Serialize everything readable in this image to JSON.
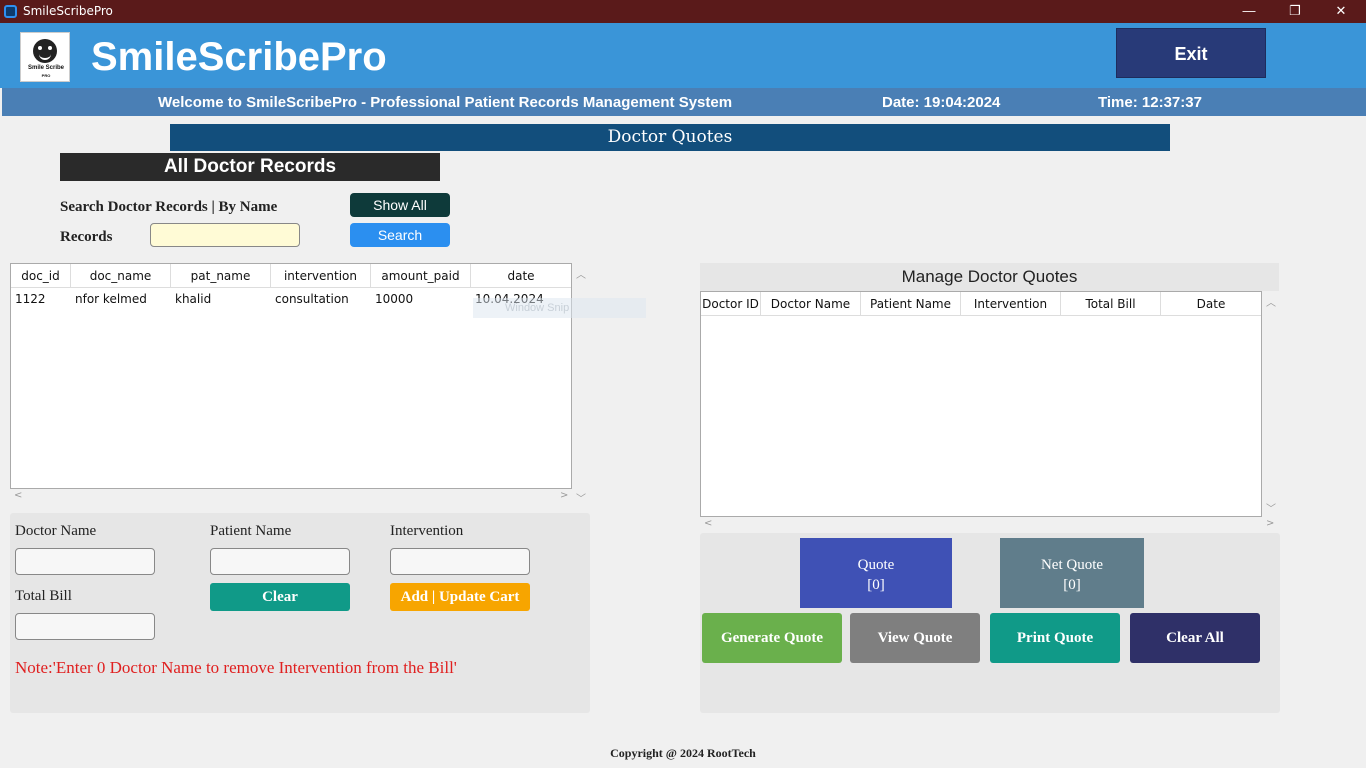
{
  "window": {
    "title": "SmileScribePro",
    "minimize": "—",
    "maximize": "❐",
    "close": "✕"
  },
  "header": {
    "logo_text": "Smile Scribe",
    "logo_subtext": "PRO",
    "brand": "SmileScribePro",
    "exit_label": "Exit"
  },
  "welcome": {
    "message": "Welcome to SmileScribePro - Professional Patient Records Management System",
    "date": "Date: 19:04:2024",
    "time": "Time: 12:37:37"
  },
  "section_title": "Doctor Quotes",
  "records": {
    "heading": "All Doctor Records",
    "search_label": "Search Doctor Records | By Name",
    "records_label": "Records",
    "search_value": "",
    "show_all_label": "Show All",
    "search_button_label": "Search",
    "columns": [
      "doc_id",
      "doc_name",
      "pat_name",
      "intervention",
      "amount_paid",
      "date"
    ],
    "rows": [
      [
        "1122",
        "nfor kelmed",
        "khalid",
        "consultation",
        "10000",
        "10.04.2024"
      ]
    ],
    "ghost_text": "Window Snip"
  },
  "form": {
    "doctor_name_label": "Doctor Name",
    "patient_name_label": "Patient Name",
    "intervention_label": "Intervention",
    "total_bill_label": "Total Bill",
    "doctor_name_value": "",
    "patient_name_value": "",
    "intervention_value": "",
    "total_bill_value": "",
    "clear_label": "Clear",
    "add_update_label": "Add | Update Cart",
    "note": "Note:'Enter 0 Doctor Name to remove Intervention from the Bill'"
  },
  "quotes": {
    "title": "Manage Doctor Quotes",
    "columns": [
      "Doctor ID",
      "Doctor Name",
      "Patient Name",
      "Intervention",
      "Total Bill",
      "Date"
    ],
    "quote_label": "Quote",
    "quote_value": "[0]",
    "net_quote_label": "Net Quote",
    "net_quote_value": "[0]",
    "generate_label": "Generate Quote",
    "view_label": "View Quote",
    "print_label": "Print Quote",
    "clear_all_label": "Clear All"
  },
  "copyright": "Copyright @ 2024 RootTech",
  "colors": {
    "titlebar": "#5a1a1a",
    "header": "#3a95d8",
    "welcome_bar": "#4a7fb5",
    "section_title": "#124e7c",
    "exit": "#283a78",
    "generate": "#6ab04c",
    "view": "#7f7f7f",
    "print": "#109a88",
    "clear_all": "#2f3068",
    "note": "#e02020"
  }
}
